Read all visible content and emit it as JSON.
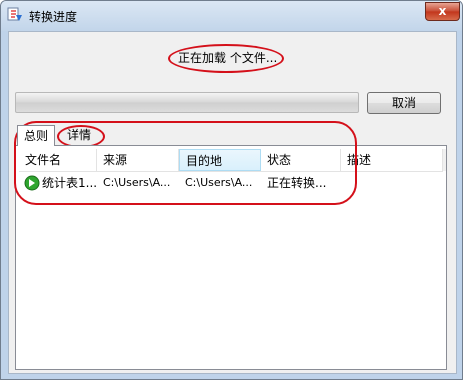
{
  "window": {
    "title": "转换进度",
    "close_label": "x"
  },
  "status": {
    "loading_text": "正在加载 个文件..."
  },
  "progress": {
    "fraction": 0.0
  },
  "buttons": {
    "cancel_label": "取消"
  },
  "tabs": [
    {
      "label": "总则"
    },
    {
      "label": "详情"
    }
  ],
  "table": {
    "columns": [
      "文件名",
      "来源",
      "目的地",
      "状态",
      "描述"
    ],
    "rows": [
      {
        "icon": "convert-icon",
        "file_name": "统计表1...",
        "source": "C:\\Users\\A...",
        "destination": "C:\\Users\\A...",
        "status": "正在转换...",
        "description": ""
      }
    ]
  },
  "colors": {
    "annotation_red": "#d4101a",
    "progress_green": "#37c537",
    "titlebar": "#c2d5ea"
  }
}
